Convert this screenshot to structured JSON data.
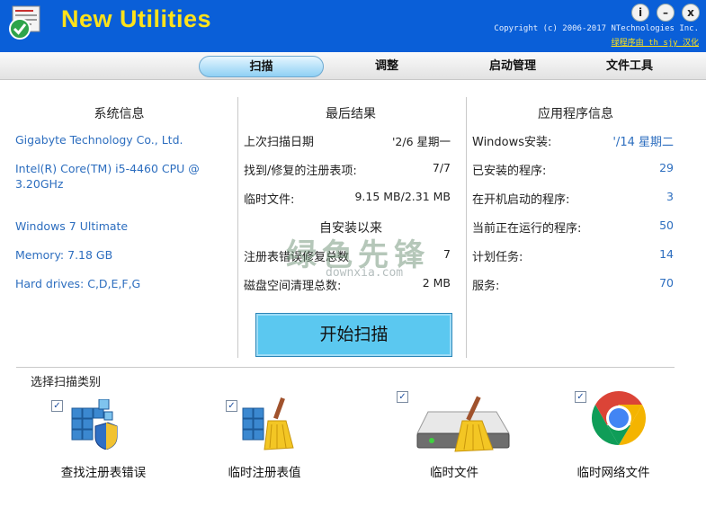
{
  "app": {
    "title": "New Utilities",
    "copyright": "Copyright (c) 2006-2017 NTechnologies Inc.",
    "credit": "绿程序由 th_sjy 汉化"
  },
  "window_controls": {
    "info": "i",
    "minimize": "–",
    "close": "x"
  },
  "tabs": [
    {
      "label": "扫描",
      "active": true
    },
    {
      "label": "调整",
      "active": false
    },
    {
      "label": "启动管理",
      "active": false
    },
    {
      "label": "文件工具",
      "active": false
    }
  ],
  "system_info": {
    "title": "系统信息",
    "items": [
      "Gigabyte Technology Co., Ltd.",
      "Intel(R) Core(TM) i5-4460  CPU @ 3.20GHz",
      "Windows 7 Ultimate",
      "Memory: 7.18 GB",
      "Hard drives: C,D,E,F,G"
    ]
  },
  "last_results": {
    "title": "最后结果",
    "rows": [
      {
        "label": "上次扫描日期",
        "value": "'2/6 星期一"
      },
      {
        "label": "找到/修复的注册表项:",
        "value": "7/7"
      },
      {
        "label": "临时文件:",
        "value": "9.15 MB/2.31 MB"
      }
    ],
    "since_title": "自安装以来",
    "since_rows": [
      {
        "label": "注册表错误修复总数",
        "value": "7"
      },
      {
        "label": "磁盘空间清理总数:",
        "value": "2 MB"
      }
    ]
  },
  "app_info": {
    "title": "应用程序信息",
    "rows": [
      {
        "label": "Windows安装:",
        "value": "'/14 星期二"
      },
      {
        "label": "已安装的程序:",
        "value": "29"
      },
      {
        "label": "在开机启动的程序:",
        "value": "3"
      },
      {
        "label": "当前正在运行的程序:",
        "value": "50"
      },
      {
        "label": "计划任务:",
        "value": "14"
      },
      {
        "label": "服务:",
        "value": "70"
      }
    ]
  },
  "scan_button": "开始扫描",
  "categories": {
    "title": "选择扫描类别",
    "items": [
      {
        "label": "查找注册表错误",
        "checked": true,
        "icon": "registry-shield-icon"
      },
      {
        "label": "临时注册表值",
        "checked": true,
        "icon": "registry-broom-icon"
      },
      {
        "label": "临时文件",
        "checked": true,
        "icon": "drive-broom-icon"
      },
      {
        "label": "临时网络文件",
        "checked": true,
        "icon": "chrome-icon"
      }
    ]
  },
  "watermark": {
    "text": "绿色先锋",
    "sub": "downxia.com"
  },
  "colors": {
    "titlebar": "#0a5fd8",
    "title_text": "#ffe21a",
    "link_blue": "#2d6ebf",
    "scan_button": "#5bc8f0"
  }
}
